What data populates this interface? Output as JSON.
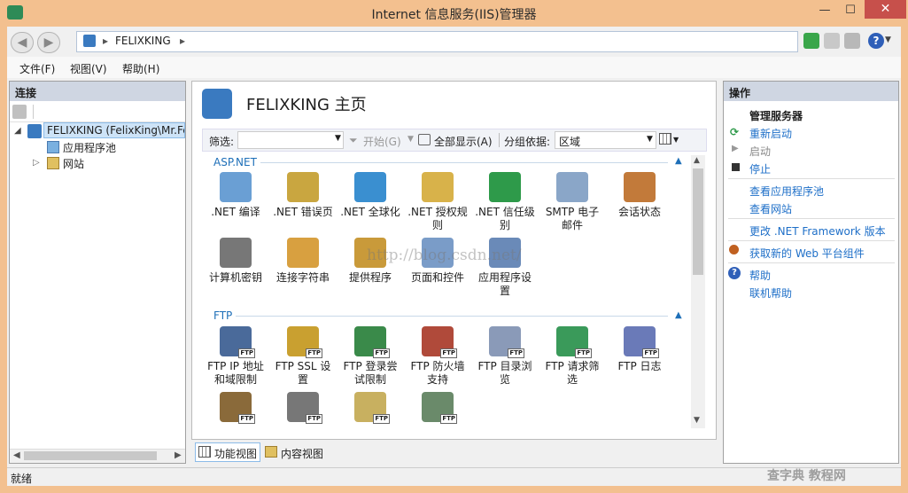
{
  "window": {
    "title": "Internet 信息服务(IIS)管理器",
    "min": "—",
    "max": "☐",
    "close": "✕"
  },
  "address": {
    "crumbs": [
      "FELIXKING"
    ],
    "sep": "▸"
  },
  "menu": [
    "文件(F)",
    "视图(V)",
    "帮助(H)"
  ],
  "connections": {
    "header": "连接",
    "tree": {
      "server": "FELIXKING (FelixKing\\Mr.Fe",
      "apppools": "应用程序池",
      "sites": "网站"
    }
  },
  "main": {
    "title": "FELIXKING 主页",
    "filter_label": "筛选:",
    "start": "开始(G)",
    "showall": "全部显示(A)",
    "groupby_label": "分组依据:",
    "groupby_value": "区域",
    "groups": {
      "aspnet": "ASP.NET",
      "ftp": "FTP"
    },
    "aspnet_features": [
      {
        "l1": ".NET 编译",
        "l2": "",
        "icon": "compile-icon",
        "color": "#6a9fd4"
      },
      {
        "l1": ".NET 错误页",
        "l2": "",
        "icon": "error-page-icon",
        "color": "#c9a640"
      },
      {
        "l1": ".NET 全球化",
        "l2": "",
        "icon": "globe-icon",
        "color": "#3a8fd0"
      },
      {
        "l1": ".NET 授权规",
        "l2": "则",
        "icon": "auth-rules-icon",
        "color": "#d8b24a"
      },
      {
        "l1": ".NET 信任级",
        "l2": "别",
        "icon": "trust-icon",
        "color": "#2e9a4a"
      },
      {
        "l1": "SMTP 电子",
        "l2": "邮件",
        "icon": "smtp-icon",
        "color": "#8aa6c8"
      },
      {
        "l1": "会话状态",
        "l2": "",
        "icon": "session-icon",
        "color": "#c27a3a"
      },
      {
        "l1": "计算机密钥",
        "l2": "",
        "icon": "machine-key-icon",
        "color": "#777"
      },
      {
        "l1": "连接字符串",
        "l2": "",
        "icon": "conn-string-icon",
        "color": "#d8a040"
      },
      {
        "l1": "提供程序",
        "l2": "",
        "icon": "providers-icon",
        "color": "#c99a3a"
      },
      {
        "l1": "页面和控件",
        "l2": "",
        "icon": "pages-icon",
        "color": "#7a9cc8"
      },
      {
        "l1": "应用程序设",
        "l2": "置",
        "icon": "app-settings-icon",
        "color": "#6a8ab8"
      }
    ],
    "ftp_features": [
      {
        "l1": "FTP IP 地址",
        "l2": "和域限制",
        "icon": "ftp-ip-icon",
        "color": "#4a6a9a"
      },
      {
        "l1": "FTP SSL 设",
        "l2": "置",
        "icon": "ftp-ssl-icon",
        "color": "#c9a030"
      },
      {
        "l1": "FTP 登录尝",
        "l2": "试限制",
        "icon": "ftp-logon-icon",
        "color": "#3a8a4a"
      },
      {
        "l1": "FTP 防火墙",
        "l2": "支持",
        "icon": "ftp-firewall-icon",
        "color": "#b04a3a"
      },
      {
        "l1": "FTP 目录浏",
        "l2": "览",
        "icon": "ftp-browse-icon",
        "color": "#8a9ab8"
      },
      {
        "l1": "FTP 请求筛",
        "l2": "选",
        "icon": "ftp-filter-icon",
        "color": "#3a9a5a"
      },
      {
        "l1": "FTP 日志",
        "l2": "",
        "icon": "ftp-log-icon",
        "color": "#6a7ab8"
      },
      {
        "l1": "",
        "l2": "",
        "icon": "ftp-user-icon",
        "color": "#8a6a3a"
      },
      {
        "l1": "",
        "l2": "",
        "icon": "ftp-key-icon",
        "color": "#777"
      },
      {
        "l1": "",
        "l2": "",
        "icon": "ftp-msg-icon",
        "color": "#c8b060"
      },
      {
        "l1": "",
        "l2": "",
        "icon": "ftp-auth-icon",
        "color": "#6a8a6a"
      }
    ],
    "tabs": {
      "features": "功能视图",
      "content": "内容视图"
    }
  },
  "actions": {
    "header": "操作",
    "group": "管理服务器",
    "restart": "重新启动",
    "start": "启动",
    "stop": "停止",
    "view_pools": "查看应用程序池",
    "view_sites": "查看网站",
    "change_net": "更改 .NET Framework 版本",
    "get_platform": "获取新的 Web 平台组件",
    "help": "帮助",
    "online_help": "联机帮助"
  },
  "status": "就绪",
  "watermark": "http://blog.csdn.net/",
  "corner_watermark": "查字典 教程网"
}
